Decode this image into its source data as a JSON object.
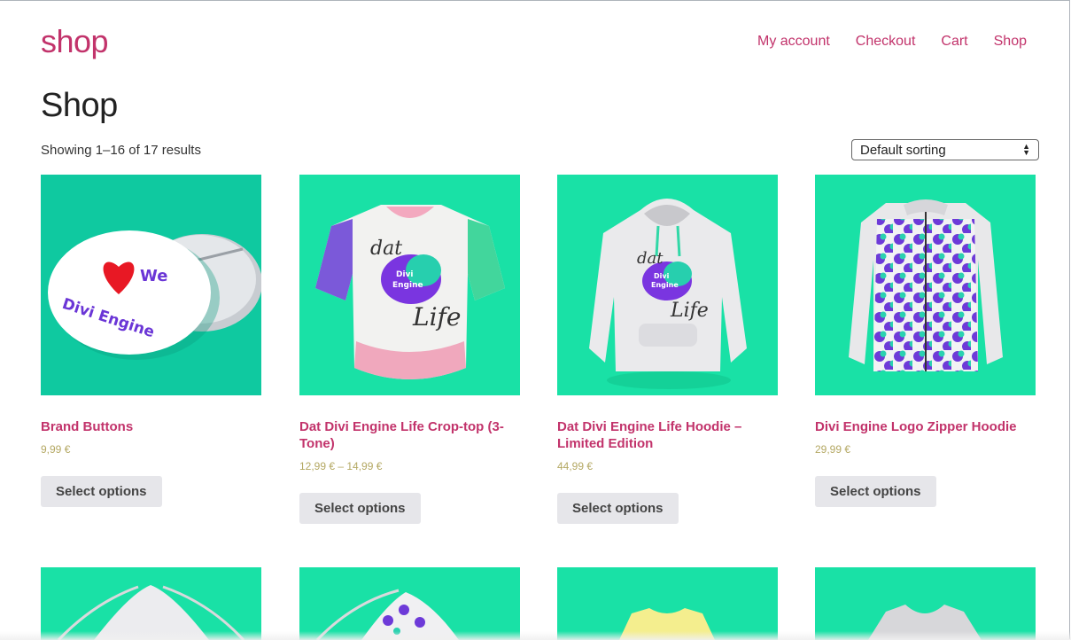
{
  "site": {
    "title": "shop"
  },
  "nav": {
    "items": [
      "My account",
      "Checkout",
      "Cart",
      "Shop"
    ]
  },
  "page": {
    "title": "Shop",
    "result_count": "Showing 1–16 of 17 results",
    "sorting": {
      "selected": "Default sorting"
    }
  },
  "products": [
    {
      "name": "Brand Buttons",
      "price": "9,99 €",
      "button": "Select options",
      "image": "brand-buttons-image"
    },
    {
      "name": "Dat Divi Engine Life Crop-top (3-Tone)",
      "price": "12,99 € – 14,99 €",
      "button": "Select options",
      "image": "crop-top-image"
    },
    {
      "name": "Dat Divi Engine Life Hoodie – Limited Edition",
      "price": "44,99 €",
      "button": "Select options",
      "image": "hoodie-image"
    },
    {
      "name": "Divi Engine Logo Zipper Hoodie",
      "price": "29,99 €",
      "button": "Select options",
      "image": "zipper-hoodie-image"
    }
  ],
  "next_row_images": [
    "drawstring-bag-image",
    "patterned-bag-image",
    "yellow-tshirt-image",
    "grey-tshirt-image"
  ],
  "colors": {
    "accent": "#c2336b",
    "price": "#b4a863",
    "product_bg": "#19e1a6",
    "button_bg": "#e6e6ea"
  }
}
